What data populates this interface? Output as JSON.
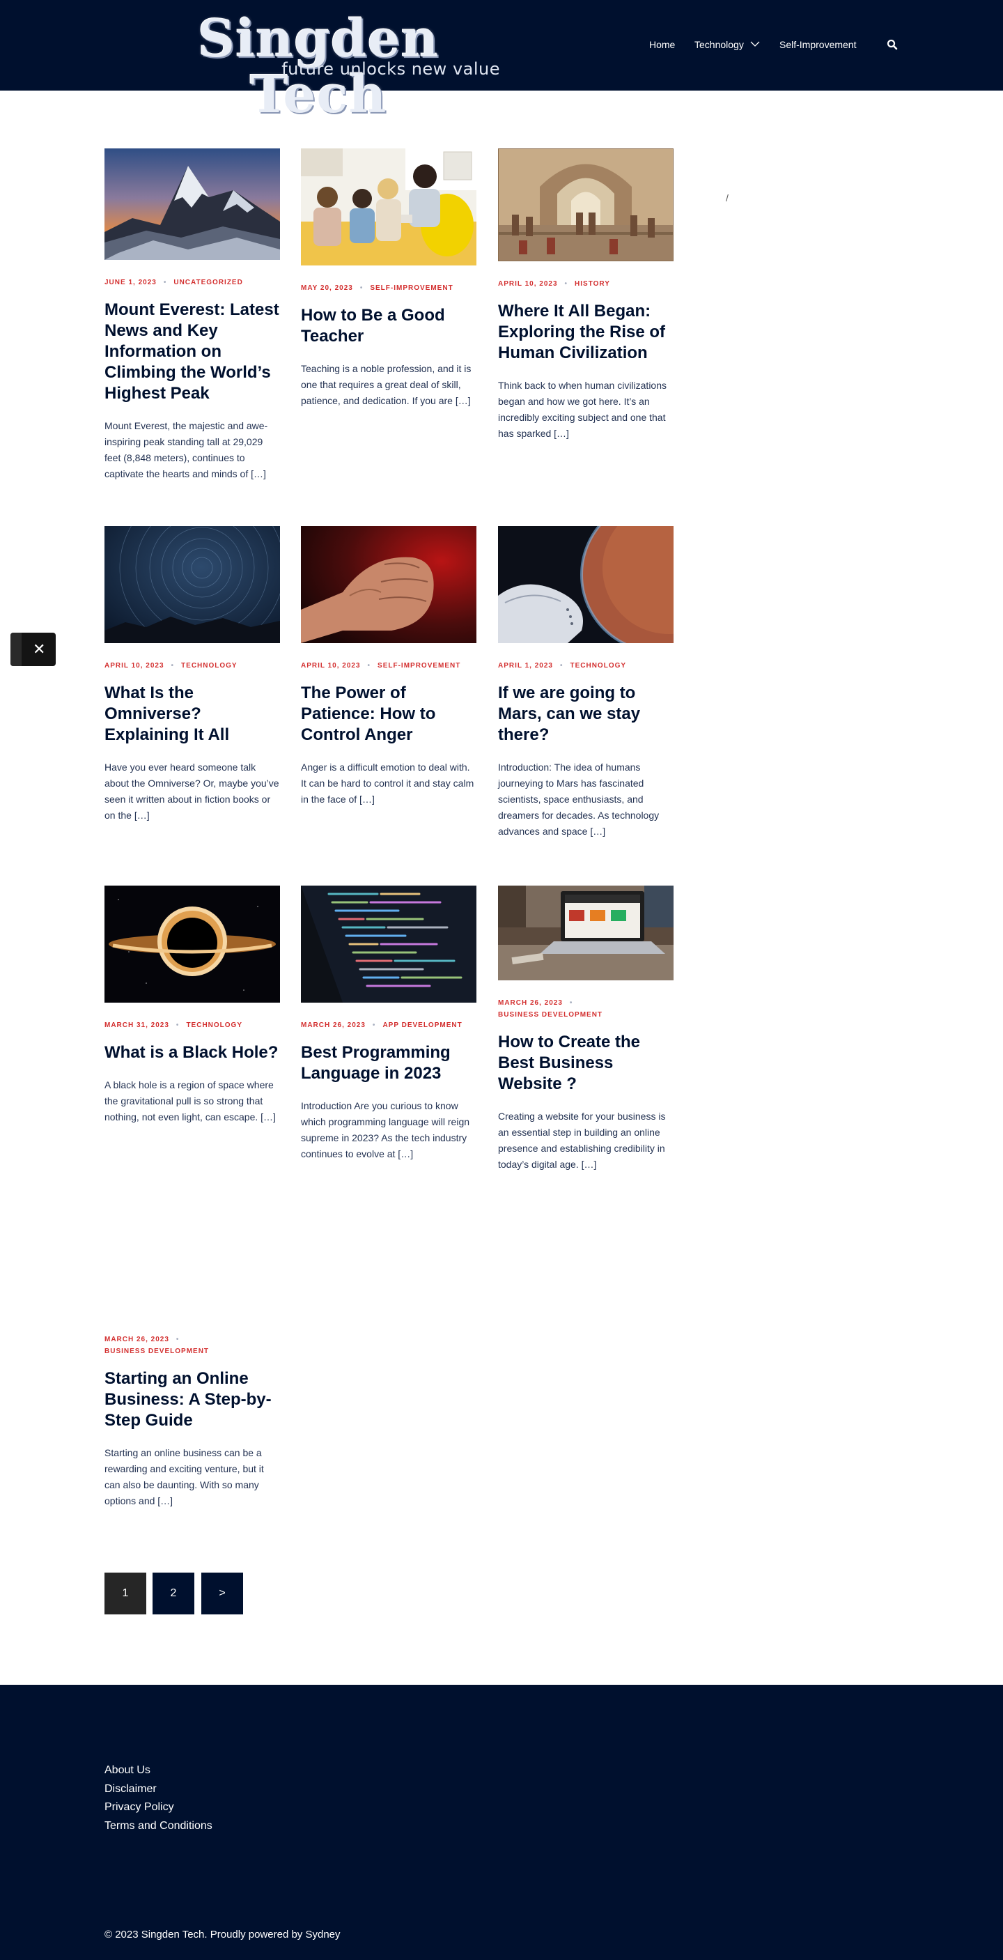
{
  "header": {
    "logo_title": "Singden Tech",
    "logo_tagline": "future unlocks new value",
    "nav": {
      "home": "Home",
      "technology": "Technology",
      "self_improvement": "Self-Improvement"
    },
    "icons": [
      "chevron-down-icon",
      "search-icon"
    ]
  },
  "sidebar": {
    "slash": "/"
  },
  "posts": [
    {
      "date": "June 1, 2023",
      "category": "Uncategorized",
      "title": "Mount Everest: Latest News and Key Information on Climbing the World’s Highest Peak",
      "excerpt": "Mount Everest, the majestic and awe-inspiring peak standing tall at 29,029 feet (8,848 meters), continues to captivate the hearts and minds of […]"
    },
    {
      "date": "May 20, 2023",
      "category": "Self-Improvement",
      "title": "How to Be a Good Teacher",
      "excerpt": "Teaching is a noble profession, and it is one that requires a great deal of skill, patience, and dedication. If you are […]"
    },
    {
      "date": "April 10, 2023",
      "category": "History",
      "title": "Where It All Began: Exploring the Rise of Human Civilization",
      "excerpt": "Think back to when human civilizations began and how we got here. It’s an incredibly exciting subject and one that has sparked […]"
    },
    {
      "date": "April 10, 2023",
      "category": "Technology",
      "title": "What Is the Omniverse? Explaining It All",
      "excerpt": "Have you ever heard someone talk about the Omniverse? Or, maybe you’ve seen it written about in fiction books or on the […]"
    },
    {
      "date": "April 10, 2023",
      "category": "Self-Improvement",
      "title": "The Power of Patience: How to Control Anger",
      "excerpt": "Anger is a difficult emotion to deal with. It can be hard to control it and stay calm in the face of […]"
    },
    {
      "date": "April 1, 2023",
      "category": "Technology",
      "title": "If we are going to Mars, can we stay there?",
      "excerpt": "Introduction: The idea of humans journeying to Mars has fascinated scientists, space enthusiasts, and dreamers for decades. As technology advances and space […]"
    },
    {
      "date": "March 31, 2023",
      "category": "Technology",
      "title": "What is a Black Hole?",
      "excerpt": "A black hole is a region of space where the gravitational pull is so strong that nothing, not even light, can escape. […]"
    },
    {
      "date": "March 26, 2023",
      "category": "App Development",
      "title": "Best Programming Language in 2023",
      "excerpt": "Introduction Are you curious to know which programming language will reign supreme in 2023? As the tech industry continues to evolve at […]"
    },
    {
      "date": "March 26, 2023",
      "category": "Business Development",
      "title": "How to Create the Best Business Website ?",
      "excerpt": "Creating a website for your business is an essential step in building an online presence and establishing credibility in today’s digital age. […]"
    },
    {
      "date": "March 26, 2023",
      "category": "Business Development",
      "title": "Starting an Online Business: A Step-by-Step Guide",
      "excerpt": "Starting an online business can be a rewarding and exciting venture, but it can also be daunting. With so many options and […]"
    }
  ],
  "floating": {
    "close_symbol": "✕"
  },
  "pagination": {
    "page1": "1",
    "page2": "2",
    "next": ">"
  },
  "footer": {
    "links": [
      "About Us",
      "Disclaimer",
      "Privacy Policy",
      "Terms and Conditions"
    ],
    "copyright_prefix": "© 2023 Singden Tech. Proudly powered by ",
    "copyright_link": "Sydney"
  },
  "colors": {
    "navy": "#00102e",
    "accent_red": "#d32f2f",
    "text_body": "#233252",
    "pager_active": "#262626"
  }
}
